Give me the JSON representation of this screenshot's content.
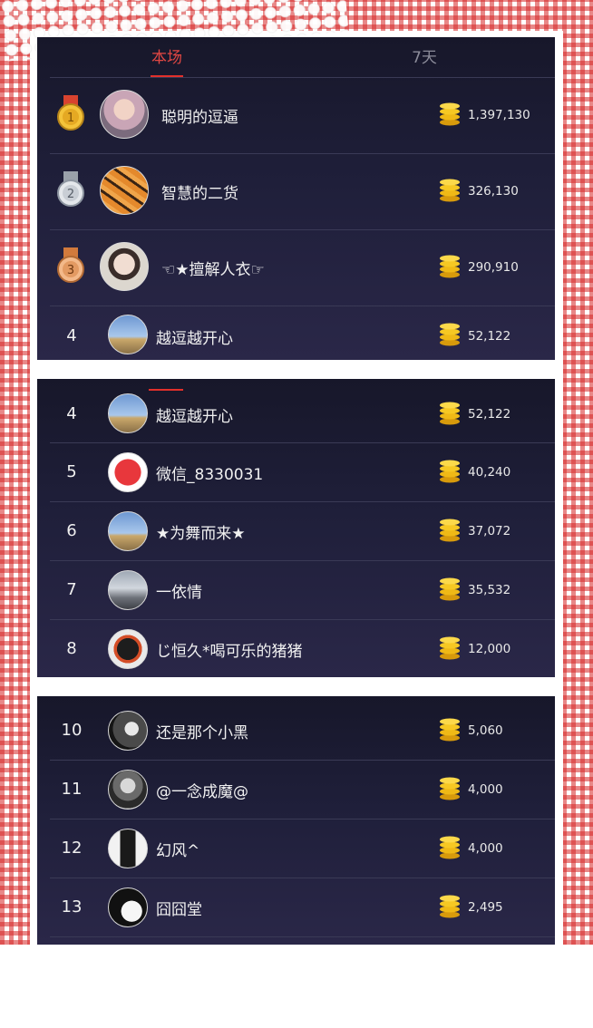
{
  "tabs": [
    {
      "label": "本场",
      "active": true
    },
    {
      "label": "7天",
      "active": false
    }
  ],
  "colors": {
    "accent": "#e2302b",
    "gold": "#f5c218",
    "panel": "#1f1f3a",
    "check": "#d62626"
  },
  "panel1": {
    "rows": [
      {
        "rank": "1",
        "medal": "gold-medal-icon",
        "name": "聪明的逗逼",
        "amount": "1,397,130",
        "avatar": "avatar-girl"
      },
      {
        "rank": "2",
        "medal": "silver-medal-icon",
        "name": "智慧的二货",
        "amount": "326,130",
        "avatar": "avatar-tiger"
      },
      {
        "rank": "3",
        "medal": "bronze-medal-icon",
        "name": "☜★擅解人衣☞",
        "amount": "290,910",
        "avatar": "avatar-boy"
      },
      {
        "rank": "4",
        "name": "越逗越开心",
        "amount": "52,122",
        "avatar": "avatar-sky"
      }
    ]
  },
  "panel2": {
    "rows": [
      {
        "rank": "4",
        "name": "越逗越开心",
        "amount": "52,122",
        "avatar": "avatar-sky"
      },
      {
        "rank": "5",
        "name": "微信_8330031",
        "amount": "40,240",
        "avatar": "avatar-red-face"
      },
      {
        "rank": "6",
        "name": "★为舞而来★",
        "amount": "37,072",
        "avatar": "avatar-sky"
      },
      {
        "rank": "7",
        "name": "一依情",
        "amount": "35,532",
        "avatar": "avatar-road"
      },
      {
        "rank": "8",
        "name": "じ恒久*喝可乐的猪猪",
        "amount": "12,000",
        "avatar": "avatar-badge"
      }
    ]
  },
  "panel3": {
    "rows": [
      {
        "rank": "10",
        "name": "还是那个小黑",
        "amount": "5,060",
        "avatar": "avatar-dark"
      },
      {
        "rank": "11",
        "name": "@一念成魔@",
        "amount": "4,000",
        "avatar": "avatar-man"
      },
      {
        "rank": "12",
        "name": "幻风^",
        "amount": "4,000",
        "avatar": "avatar-figure"
      },
      {
        "rank": "13",
        "name": "囧囧堂",
        "amount": "2,495",
        "avatar": "avatar-anime"
      }
    ]
  }
}
